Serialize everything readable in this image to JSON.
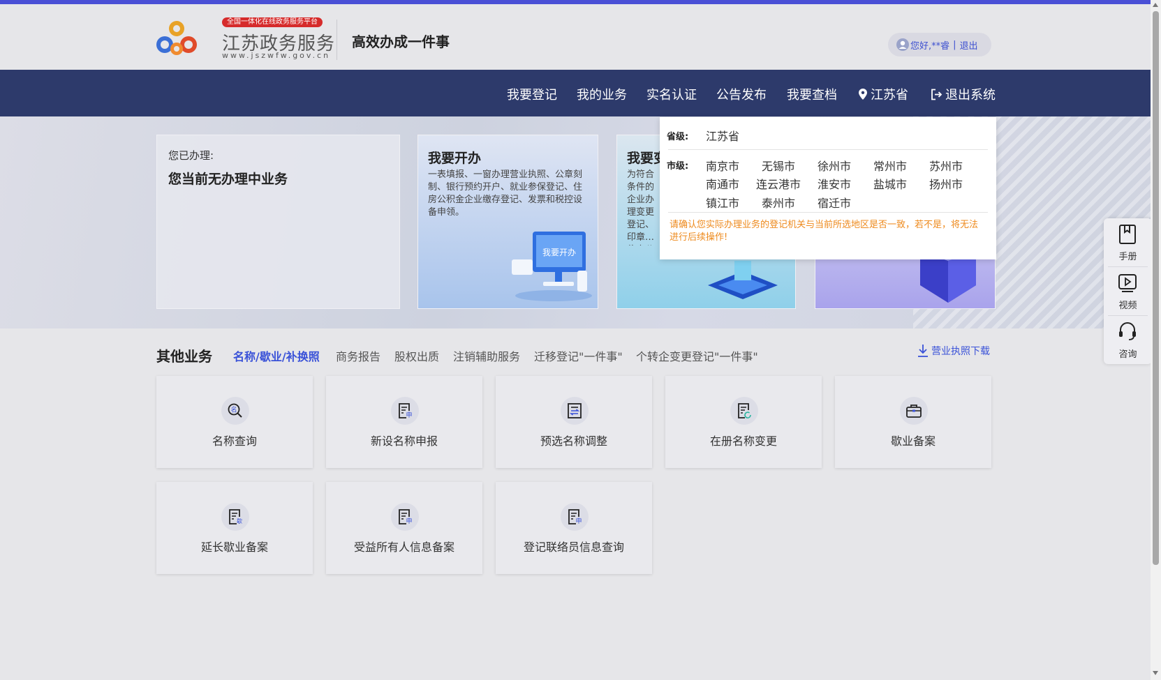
{
  "header": {
    "platform_badge": "全国一体化在线政务服务平台",
    "brand_name": "江苏政务服务",
    "brand_url": "www.jszwfw.gov.cn",
    "slogan": "高效办成一件事",
    "user_greeting": "您好,**睿",
    "logout_link": "退出"
  },
  "nav": {
    "items": [
      "我要登记",
      "我的业务",
      "实名认证",
      "公告发布",
      "我要查档"
    ],
    "region": "江苏省",
    "exit_system": "退出系统"
  },
  "banner": {
    "handled_label": "您已办理:",
    "handled_status": "您当前无办理中业务",
    "card_kaiban_title": "我要开办",
    "card_kaiban_desc": "一表填报、一窗办理营业执照、公章刻制、银行预约开户、就业参保登记、住房公积金企业缴存登记、发票和税控设备申领。",
    "card_kaiban_image_text": "我要开办",
    "card_change_title": "我要变",
    "card_change_desc": "为符合条件的企业办理变更登记、印章…住房公积…设备变更…许可（即…务。"
  },
  "region_popup": {
    "province_label": "省级:",
    "province": "江苏省",
    "city_label": "市级:",
    "cities": [
      "南京市",
      "无锡市",
      "徐州市",
      "常州市",
      "苏州市",
      "南通市",
      "连云港市",
      "淮安市",
      "盐城市",
      "扬州市",
      "镇江市",
      "泰州市",
      "宿迁市"
    ],
    "warning": "请确认您实际办理业务的登记机关与当前所选地区是否一致，若不是，将无法进行后续操作!"
  },
  "side_tools": [
    {
      "label": "手册",
      "icon": "manual-icon"
    },
    {
      "label": "视频",
      "icon": "video-icon"
    },
    {
      "label": "咨询",
      "icon": "consult-icon"
    }
  ],
  "other_business": {
    "title": "其他业务",
    "tabs": [
      "名称/歇业/补换照",
      "商务报告",
      "股权出质",
      "注销辅助服务",
      "迁移登记\"一件事\"",
      "个转企变更登记\"一件事\""
    ],
    "active_tab": 0,
    "download_link": "营业执照下载",
    "tiles": [
      {
        "label": "名称查询",
        "icon": "name-search-icon",
        "glyph": "名"
      },
      {
        "label": "新设名称申报",
        "icon": "new-name-apply-icon",
        "glyph": "申"
      },
      {
        "label": "预选名称调整",
        "icon": "name-adjust-icon",
        "glyph": "⇆"
      },
      {
        "label": "在册名称变更",
        "icon": "name-change-icon",
        "glyph": ""
      },
      {
        "label": "歇业备案",
        "icon": "suspension-filing-icon",
        "glyph": ""
      },
      {
        "label": "延长歇业备案",
        "icon": "extend-suspension-icon",
        "glyph": "歇"
      },
      {
        "label": "受益所有人信息备案",
        "icon": "beneficial-owner-icon",
        "glyph": "申"
      },
      {
        "label": "登记联络员信息查询",
        "icon": "liaison-query-icon",
        "glyph": "申"
      }
    ]
  },
  "colors": {
    "nav_bg": "#2d3a6b",
    "accent": "#3a52d8",
    "top_line": "#4a50d6",
    "warning": "#ee8a1d",
    "badge": "#d62b2b"
  }
}
